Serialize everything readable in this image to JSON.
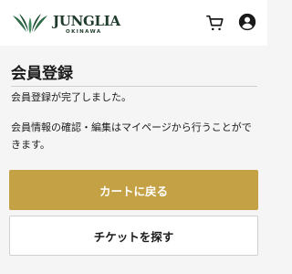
{
  "header": {
    "logo_text": "JUNGLIA",
    "logo_subtext": "OKINAWA",
    "cart_icon": "cart-icon",
    "account_icon": "account-circle-icon"
  },
  "main": {
    "title": "会員登録",
    "message_completed": "会員登録が完了しました。",
    "message_info": "会員情報の確認・編集はマイページから行うことができます。"
  },
  "buttons": {
    "back_to_cart": "カートに戻る",
    "find_tickets": "チケットを探す"
  },
  "colors": {
    "accent": "#c4a145",
    "logo_green": "#1f3b2c",
    "background": "#f5f5f5"
  }
}
